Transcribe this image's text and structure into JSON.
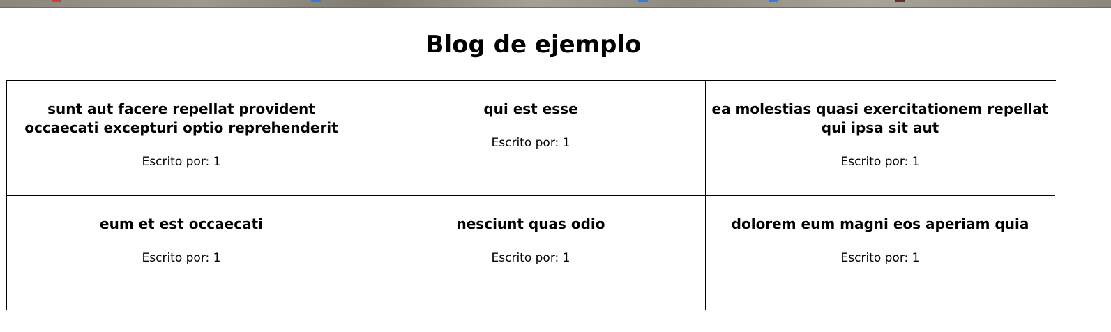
{
  "page": {
    "title": "Blog de ejemplo"
  },
  "posts": [
    {
      "title": "sunt aut facere repellat provident occaecati excepturi optio reprehenderit",
      "author_label": "Escrito por: 1"
    },
    {
      "title": "qui est esse",
      "author_label": "Escrito por: 1"
    },
    {
      "title": "ea molestias quasi exercitationem repellat qui ipsa sit aut",
      "author_label": "Escrito por: 1"
    },
    {
      "title": "eum et est occaecati",
      "author_label": "Escrito por: 1"
    },
    {
      "title": "nesciunt quas odio",
      "author_label": "Escrito por: 1"
    },
    {
      "title": "dolorem eum magni eos aperiam quia",
      "author_label": "Escrito por: 1"
    }
  ],
  "colors": {
    "border": "#000000",
    "background": "#ffffff",
    "text": "#000000"
  }
}
